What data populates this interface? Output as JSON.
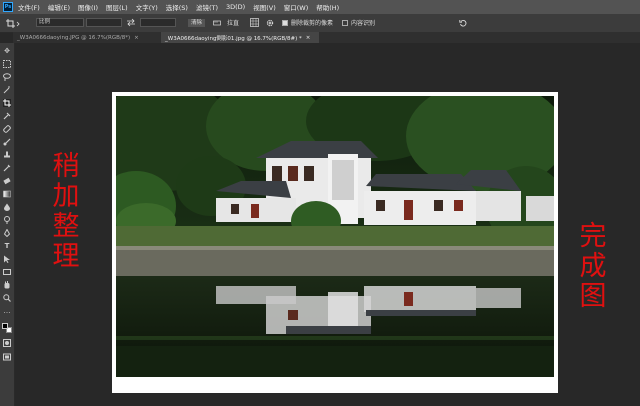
{
  "menubar": {
    "logo": "Ps",
    "items": [
      "文件(F)",
      "编辑(E)",
      "图像(I)",
      "图层(L)",
      "文字(Y)",
      "选择(S)",
      "滤镜(T)",
      "3D(D)",
      "视图(V)",
      "窗口(W)",
      "帮助(H)"
    ]
  },
  "options": {
    "ratio": "比例",
    "clear": "清除",
    "straighten": "拉直",
    "delete_cropped_label": "删除裁剪的像素",
    "delete_cropped_checked": true,
    "content_aware_label": "内容识别",
    "content_aware_checked": false
  },
  "tabs": [
    {
      "label": "_W3A0666daoying.JPG @ 16.7%(RGB/8*)",
      "active": false,
      "close": "×"
    },
    {
      "label": "_W3A0666daoying倒影01.jpg @ 16.7%(RGB/8#) *",
      "active": true,
      "close": "×"
    }
  ],
  "overlay": {
    "left_text": [
      "稍",
      "加",
      "整",
      "理"
    ],
    "right_text": [
      "完",
      "成",
      "图"
    ],
    "text_color": "#e01010"
  },
  "colors": {
    "menubar": "#535353",
    "options": "#3c3c3c",
    "workspace": "#282828",
    "accent": "#31a8ff"
  }
}
